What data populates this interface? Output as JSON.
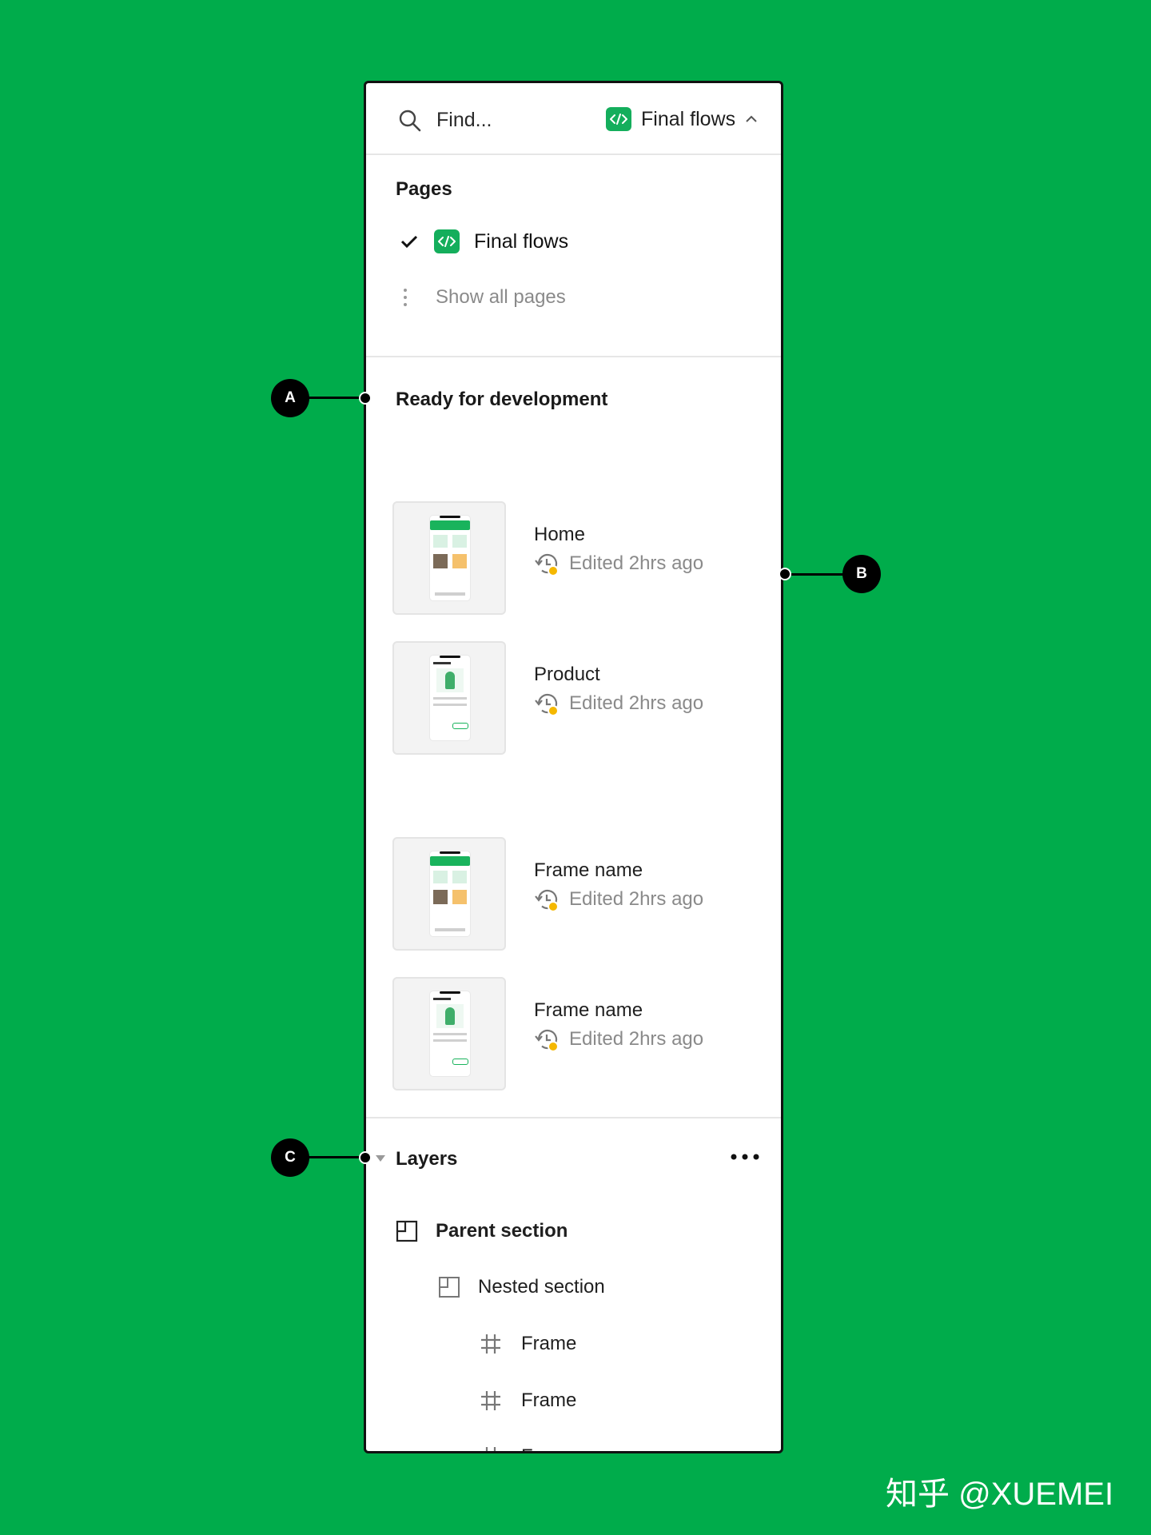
{
  "search": {
    "placeholder": "Find..."
  },
  "page_switcher": {
    "label": "Final flows",
    "icon": "dev-mode-icon"
  },
  "pages": {
    "title": "Pages",
    "current": "Final flows",
    "show_all": "Show all pages"
  },
  "ready": {
    "title": "Ready for development",
    "frames": [
      {
        "name": "Home",
        "meta": "Edited 2hrs ago"
      },
      {
        "name": "Product",
        "meta": "Edited 2hrs ago"
      },
      {
        "name": "Frame name",
        "meta": "Edited 2hrs ago"
      },
      {
        "name": "Frame name",
        "meta": "Edited 2hrs ago"
      }
    ]
  },
  "layers": {
    "title": "Layers",
    "items": [
      {
        "label": "Parent section",
        "icon": "section-icon"
      },
      {
        "label": "Nested section",
        "icon": "section-icon"
      },
      {
        "label": "Frame",
        "icon": "frame-hash-icon"
      },
      {
        "label": "Frame",
        "icon": "frame-hash-icon"
      },
      {
        "label": "Frame",
        "icon": "frame-hash-icon"
      }
    ]
  },
  "annotations": {
    "a": "A",
    "b": "B",
    "c": "C"
  },
  "watermark": "知乎 @XUEMEI",
  "colors": {
    "background": "#00AC4B",
    "accent": "#14AE5C",
    "status_dot": "#F5B800"
  }
}
